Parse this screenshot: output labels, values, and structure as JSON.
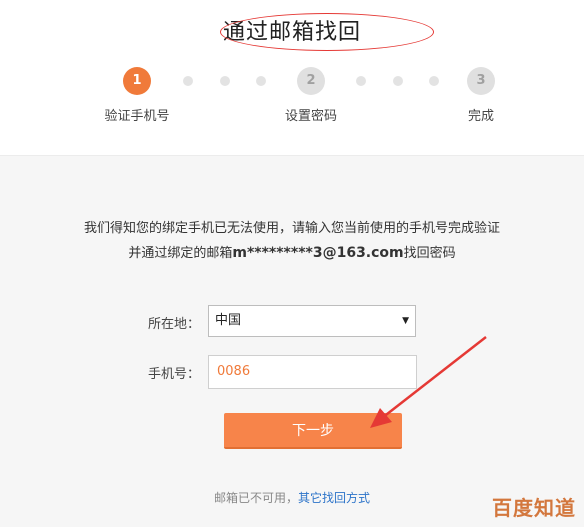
{
  "header": {
    "title": "通过邮箱找回"
  },
  "steps": [
    {
      "number": "1",
      "label": "验证手机号"
    },
    {
      "number": "2",
      "label": "设置密码"
    },
    {
      "number": "3",
      "label": "完成"
    }
  ],
  "notice": {
    "line1": "我们得知您的绑定手机已无法使用，请输入您当前使用的手机号完成验证",
    "line2_prefix": "并通过绑定的邮箱",
    "email": "m*********3@163.com",
    "line2_suffix": "找回密码"
  },
  "form": {
    "location_label": "所在地：",
    "location_value": "中国",
    "phone_label": "手机号：",
    "phone_value": "0086"
  },
  "actions": {
    "next_label": "下一步"
  },
  "footer": {
    "prefix": "邮箱已不可用，",
    "link": "其它找回方式"
  },
  "watermark": "百度知道",
  "colors": {
    "accent": "#f07a3a",
    "link": "#2d74c9",
    "annotation": "#e53935"
  }
}
